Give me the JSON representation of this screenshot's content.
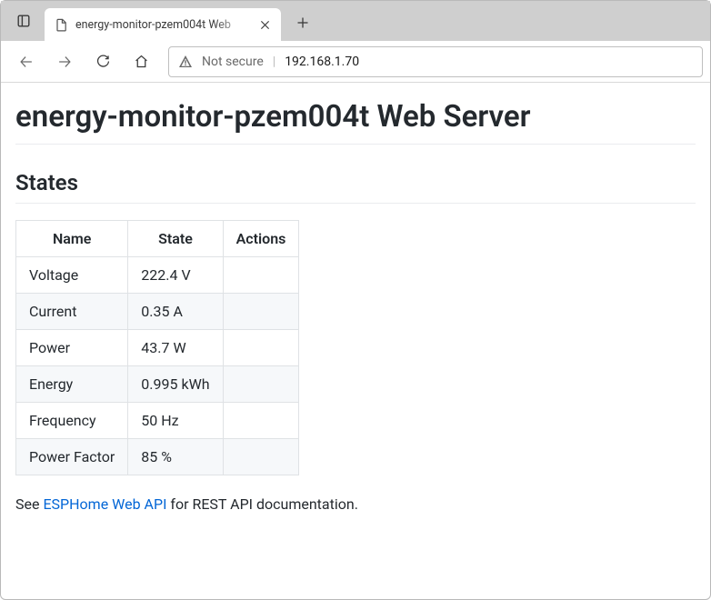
{
  "browser": {
    "tab_title": "energy-monitor-pzem004t Web",
    "security_label": "Not secure",
    "url": "192.168.1.70"
  },
  "page": {
    "title": "energy-monitor-pzem004t Web Server",
    "section_title": "States",
    "table": {
      "headers": {
        "name": "Name",
        "state": "State",
        "actions": "Actions"
      },
      "rows": [
        {
          "name": "Voltage",
          "state": "222.4 V"
        },
        {
          "name": "Current",
          "state": "0.35 A"
        },
        {
          "name": "Power",
          "state": "43.7 W"
        },
        {
          "name": "Energy",
          "state": "0.995 kWh"
        },
        {
          "name": "Frequency",
          "state": "50 Hz"
        },
        {
          "name": "Power Factor",
          "state": "85 %"
        }
      ]
    },
    "footer": {
      "prefix": "See ",
      "link_text": "ESPHome Web API",
      "suffix": " for REST API documentation."
    }
  }
}
